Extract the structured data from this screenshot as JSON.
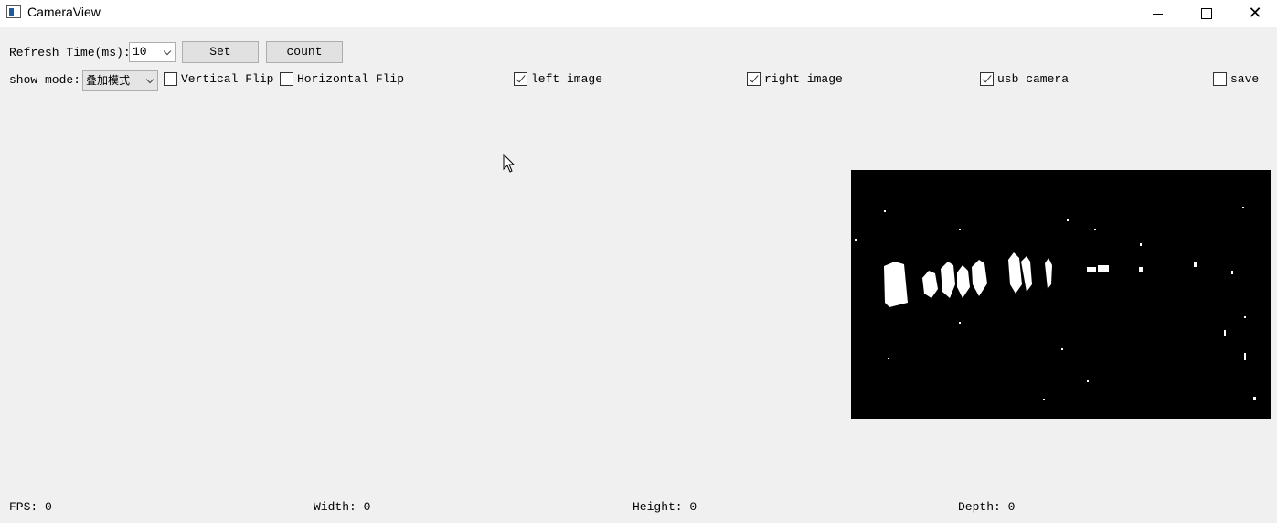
{
  "window": {
    "title": "CameraView",
    "icon": "app-window-icon",
    "controls": [
      "minimize-icon",
      "maximize-icon",
      "close-icon"
    ]
  },
  "toolbar": {
    "refresh_label": "Refresh Time(ms):",
    "refresh_value": "10",
    "set_label": "Set",
    "count_label": "count"
  },
  "options": {
    "show_mode_label": "show mode:",
    "show_mode_value": "叠加模式",
    "vertical_flip": {
      "label": "Vertical Flip",
      "checked": false
    },
    "horizontal_flip": {
      "label": "Horizontal Flip",
      "checked": false
    },
    "left_image": {
      "label": "left image",
      "checked": true
    },
    "right_image": {
      "label": "right image",
      "checked": true
    },
    "usb_camera": {
      "label": "usb camera",
      "checked": true
    },
    "save": {
      "label": "save",
      "checked": false
    }
  },
  "status": {
    "fps": "FPS: 0",
    "width": "Width: 0",
    "height": "Height: 0",
    "depth": "Depth: 0"
  }
}
